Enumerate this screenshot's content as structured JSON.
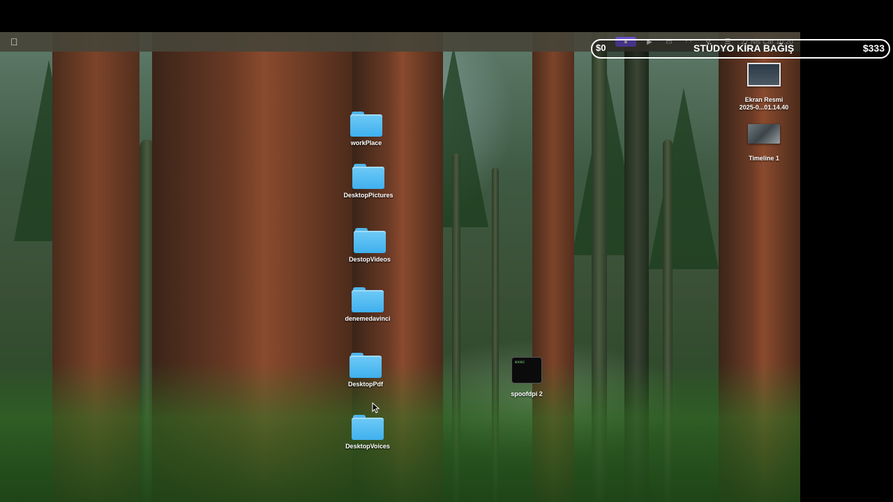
{
  "menubar": {
    "status_items": [
      "play-icon",
      "battery-icon",
      "wifi-icon",
      "search-icon",
      "control-center-icon"
    ],
    "datetime": "27 Nis Çar 10:20"
  },
  "desktop": {
    "folders": [
      {
        "label": "workPlace"
      },
      {
        "label": "DesktopPictures"
      },
      {
        "label": "DestopVideos"
      },
      {
        "label": "denemedavinci"
      },
      {
        "label": "DesktopPdf"
      },
      {
        "label": "DesktopVoices"
      }
    ],
    "files": [
      {
        "label_line1": "Ekran Resmi",
        "label_line2": "2025-0...01.14.40"
      },
      {
        "label": "Timeline 1"
      },
      {
        "label": "spoofdpi 2",
        "preview_text": "exec"
      }
    ]
  },
  "donation": {
    "left_amount": "$0",
    "title": "STÜDYO KİRA BAĞIŞ",
    "goal_amount": "$333"
  }
}
